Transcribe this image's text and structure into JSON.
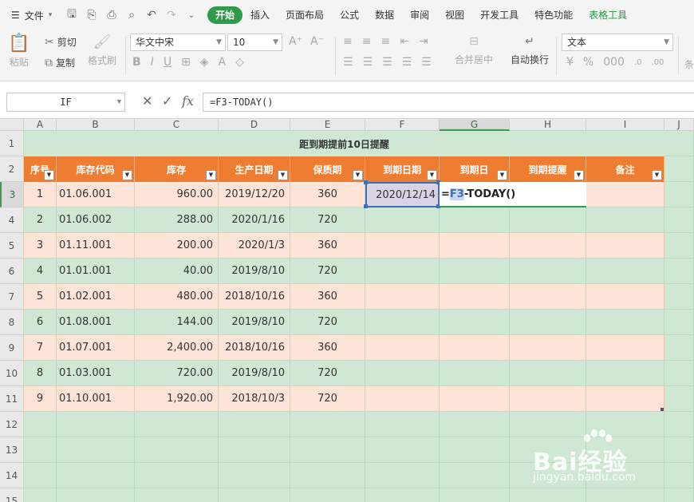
{
  "menubar": {
    "file_label": "文件",
    "tabs": [
      "开始",
      "插入",
      "页面布局",
      "公式",
      "数据",
      "审阅",
      "视图",
      "开发工具",
      "特色功能",
      "表格工具"
    ],
    "active_tab": "开始"
  },
  "ribbon": {
    "paste_label": "粘贴",
    "cut_label": "剪切",
    "copy_label": "复制",
    "format_painter_label": "格式刷",
    "font_name": "华文中宋",
    "font_size": "10",
    "merge_label": "合并居中",
    "wrap_label": "自动换行",
    "number_format": "文本",
    "cond_label": "条"
  },
  "formula_bar": {
    "name_box": "IF",
    "formula": "=F3-TODAY()"
  },
  "columns": [
    "A",
    "B",
    "C",
    "D",
    "E",
    "F",
    "G",
    "H",
    "I",
    "J"
  ],
  "rows": [
    "1",
    "2",
    "3",
    "4",
    "5",
    "6",
    "7",
    "8",
    "9",
    "10",
    "11",
    "12",
    "13",
    "14",
    "15"
  ],
  "sheet": {
    "title": "距到期提前10日提醒",
    "headers": [
      "序号",
      "库存代码",
      "库存",
      "生产日期",
      "保质期",
      "到期日期",
      "到期日",
      "到期提醒",
      "备注"
    ],
    "data": [
      [
        "1",
        "01.06.001",
        "960.00",
        "2019/12/20",
        "360"
      ],
      [
        "2",
        "01.06.002",
        "288.00",
        "2020/1/16",
        "720"
      ],
      [
        "3",
        "01.11.001",
        "200.00",
        "2020/1/3",
        "360"
      ],
      [
        "4",
        "01.01.001",
        "40.00",
        "2019/8/10",
        "720"
      ],
      [
        "5",
        "01.02.001",
        "480.00",
        "2018/10/16",
        "360"
      ],
      [
        "6",
        "01.08.001",
        "144.00",
        "2019/8/10",
        "720"
      ],
      [
        "7",
        "01.07.001",
        "2,400.00",
        "2018/10/16",
        "360"
      ],
      [
        "8",
        "01.03.001",
        "720.00",
        "2019/8/10",
        "720"
      ],
      [
        "9",
        "01.10.001",
        "1,920.00",
        "2018/10/3",
        "720"
      ]
    ],
    "f3_value": "2020/12/14",
    "g3_edit_prefix": "=",
    "g3_edit_ref": "F3",
    "g3_edit_rest": "-TODAY()"
  },
  "watermark": {
    "brand": "Bai经验",
    "url": "jingyan.baidu.com"
  },
  "colors": {
    "accent": "#2e9a4a",
    "header_orange": "#ef7d31",
    "row_peach": "#fde4d7",
    "sheet_green": "#cfe8d4"
  }
}
